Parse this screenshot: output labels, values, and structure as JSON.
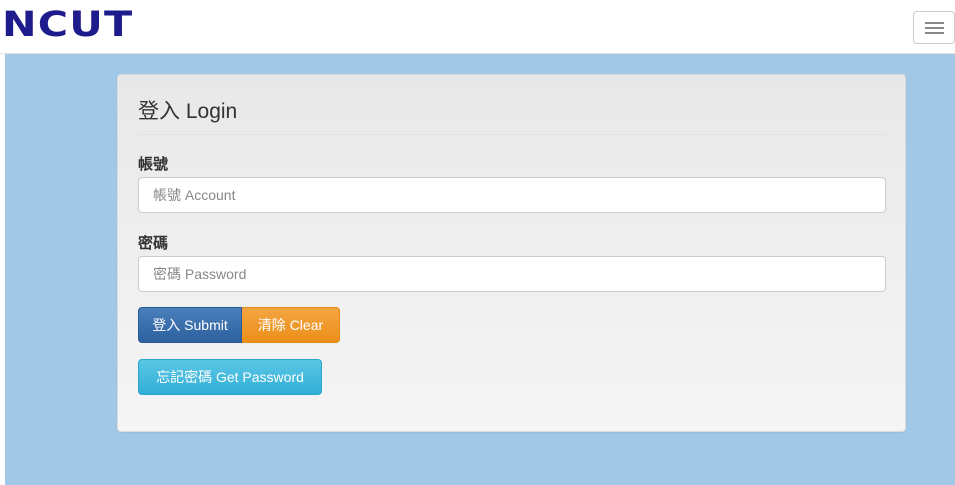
{
  "navbar": {
    "logo_text": "NCUT",
    "logo_color": "#1e1c8c",
    "toggle_icon": "hamburger-menu-icon"
  },
  "login": {
    "title": "登入 Login",
    "account_label": "帳號",
    "account_placeholder": "帳號 Account",
    "password_label": "密碼",
    "password_placeholder": "密碼 Password",
    "submit_label": "登入 Submit",
    "clear_label": "清除 Clear",
    "forgot_label": "忘記密碼 Get Password"
  },
  "colors": {
    "background": "#a1c8e7",
    "submit": "#2d609e",
    "clear": "#ec8f1a",
    "forgot": "#31afd6"
  }
}
